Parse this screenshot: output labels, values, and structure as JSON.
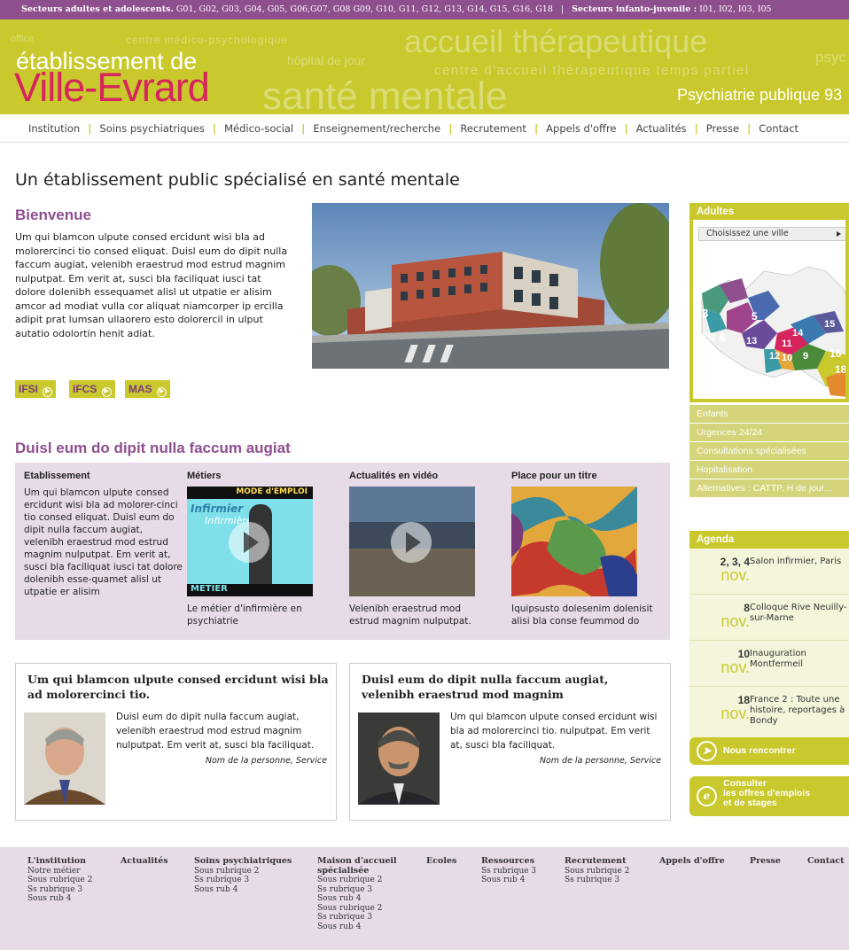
{
  "topbar": {
    "adults_label": "Secteurs adultes et adolescents.",
    "adults_list": " G01, G02, G03, G04, G05, G06,G07, G08 G09, G10, G11, G12, G13, G14, G15, G16, G18",
    "separator": "|",
    "youth_label": "Secteurs infanto-juvenile :",
    "youth_list": " I01, I02, I03, I05"
  },
  "banner": {
    "brand_line1": "établissement de",
    "brand_line2": "Ville-Evrard",
    "tagline": "Psychiatrie publique 93",
    "ghost_words": [
      "office",
      "centre médico-psychologique",
      "accueil thérapeutique",
      "hôpital de jour",
      "centre d'accueil thérapeutique temps partiel",
      "santé mentale",
      "psyc"
    ]
  },
  "nav": [
    "Institution",
    "Soins psychiatriques",
    "Médico-social",
    "Enseignement/recherche",
    "Recrutement",
    "Appels d'offre",
    "Actualités",
    "Presse",
    "Contact"
  ],
  "page_title": "Un établissement public spécialisé en santé mentale",
  "welcome": {
    "title": "Bienvenue",
    "text": "Um qui blamcon ulpute consed ercidunt wisi bla ad molorercinci tio consed eliquat. Duisl eum do dipit nulla faccum augiat, velenibh eraestrud mod estrud magnim nulputpat. Em verit at, susci bla faciliquat iusci tat dolore dolenibh essequamet alisl ut utpatie er alisim amcor ad modiat vulla cor aliquat niamcorper ip ercilla adipit prat lumsan ullaorero esto dolorercil in ulput autatio odolortin henit adiat."
  },
  "pills": [
    "IFSI",
    "IFCS",
    "MAS"
  ],
  "section": {
    "title": "Duisl eum do dipit nulla faccum augiat",
    "cols": [
      {
        "title": "Etablissement",
        "text": "Um qui blamcon ulpute consed ercidunt wisi bla ad molorer-cinci tio consed eliquat. Duisl eum do dipit nulla faccum augiat, velenibh eraestrud mod estrud magnim nulputpat. Em verit at, susci bla faciliquat iusci tat dolore dolenibh esse-quamet alisl ut utpatie er alisim"
      },
      {
        "title": "Métiers",
        "caption": "Le métier d'infirmière en psychiatrie",
        "thumb_lines": [
          "MODE d'EMPLOI",
          "Infirmier",
          "Infirmière",
          "METIER"
        ]
      },
      {
        "title": "Actualités en vidéo",
        "caption": "Velenibh eraestrud mod estrud magnim nulputpat."
      },
      {
        "title": "Place pour un titre",
        "caption": "Iquipsusto dolesenim dolenisit alisi bla conse feummod do"
      }
    ]
  },
  "cards": [
    {
      "title": "Um qui blamcon ulpute consed ercidunt wisi bla ad molorercinci tio.",
      "text": "Duisl eum do dipit nulla faccum augiat, velenibh eraestrud mod estrud magnim nulputpat. Em verit at, susci bla faciliquat.",
      "signature": "Nom de la personne, Service"
    },
    {
      "title": "Duisl eum do dipit nulla faccum augiat, velenibh eraestrud mod magnim",
      "text": "Um qui blamcon ulpute consed ercidunt wisi bla ad molorercinci tio. nulputpat. Em verit at, susci bla faciliquat.",
      "signature": "Nom de la personne, Service"
    }
  ],
  "sidebar": {
    "adults_title": "Adultes",
    "city_select": "Choisissez une ville",
    "map_numbers": [
      "3",
      "2B",
      "6",
      "5",
      "13",
      "14",
      "15",
      "12",
      "11",
      "10",
      "9",
      "16",
      "18"
    ],
    "accordion": [
      "Enfants",
      "Urgences 24/24",
      "Consultations spécialisées",
      "Hopitalisation",
      "Alternatives : CATTP, H de jour..."
    ],
    "agenda_title": "Agenda",
    "agenda": [
      {
        "day": "2, 3, 4",
        "month": "nov.",
        "text": "Salon infirmier, Paris"
      },
      {
        "day": "8",
        "month": "nov.",
        "text": "Colloque Rive Neuilly-sur-Marne"
      },
      {
        "day": "10",
        "month": "nov.",
        "text": "Inauguration Montfermeil"
      },
      {
        "day": "18",
        "month": "nov.",
        "text": "France 2 : Toute une histoire, reportages à Bondy"
      }
    ],
    "btn_meet": "Nous rencontrer",
    "btn_jobs_1": "Consulter",
    "btn_jobs_2": "les offres d'emplois",
    "btn_jobs_3": "et de stages"
  },
  "footer": [
    {
      "title": "L'institution",
      "items": [
        "Notre métier",
        "Sous rubrique 2",
        "Ss rubrique 3",
        "Sous rub 4"
      ]
    },
    {
      "title": "Actualités",
      "items": []
    },
    {
      "title": "Soins psychiatriques",
      "items": [
        "Sous rubrique 2",
        "Ss rubrique 3",
        "Sous rub 4"
      ]
    },
    {
      "title": "Maison d'accueil spécialisée",
      "items": [
        "Sous rubrique 2",
        "Ss rubrique 3",
        "Sous rub 4",
        "Sous rubrique 2",
        "Ss rubrique 3",
        "Sous rub 4"
      ]
    },
    {
      "title": "Ecoles",
      "items": []
    },
    {
      "title": "Ressources",
      "items": [
        "Ss rubrique 3",
        "Sous rub 4"
      ]
    },
    {
      "title": "Recrutement",
      "items": [
        "Sous rubrique 2",
        "Ss rubrique 3"
      ]
    },
    {
      "title": "Appels d'offre",
      "items": []
    },
    {
      "title": "Presse",
      "items": []
    },
    {
      "title": "Contact",
      "items": []
    }
  ],
  "colors": {
    "purple": "#8e4f8e",
    "olive": "#c9c92d",
    "red": "#d6245d",
    "lilac": "#e7dbe8"
  }
}
